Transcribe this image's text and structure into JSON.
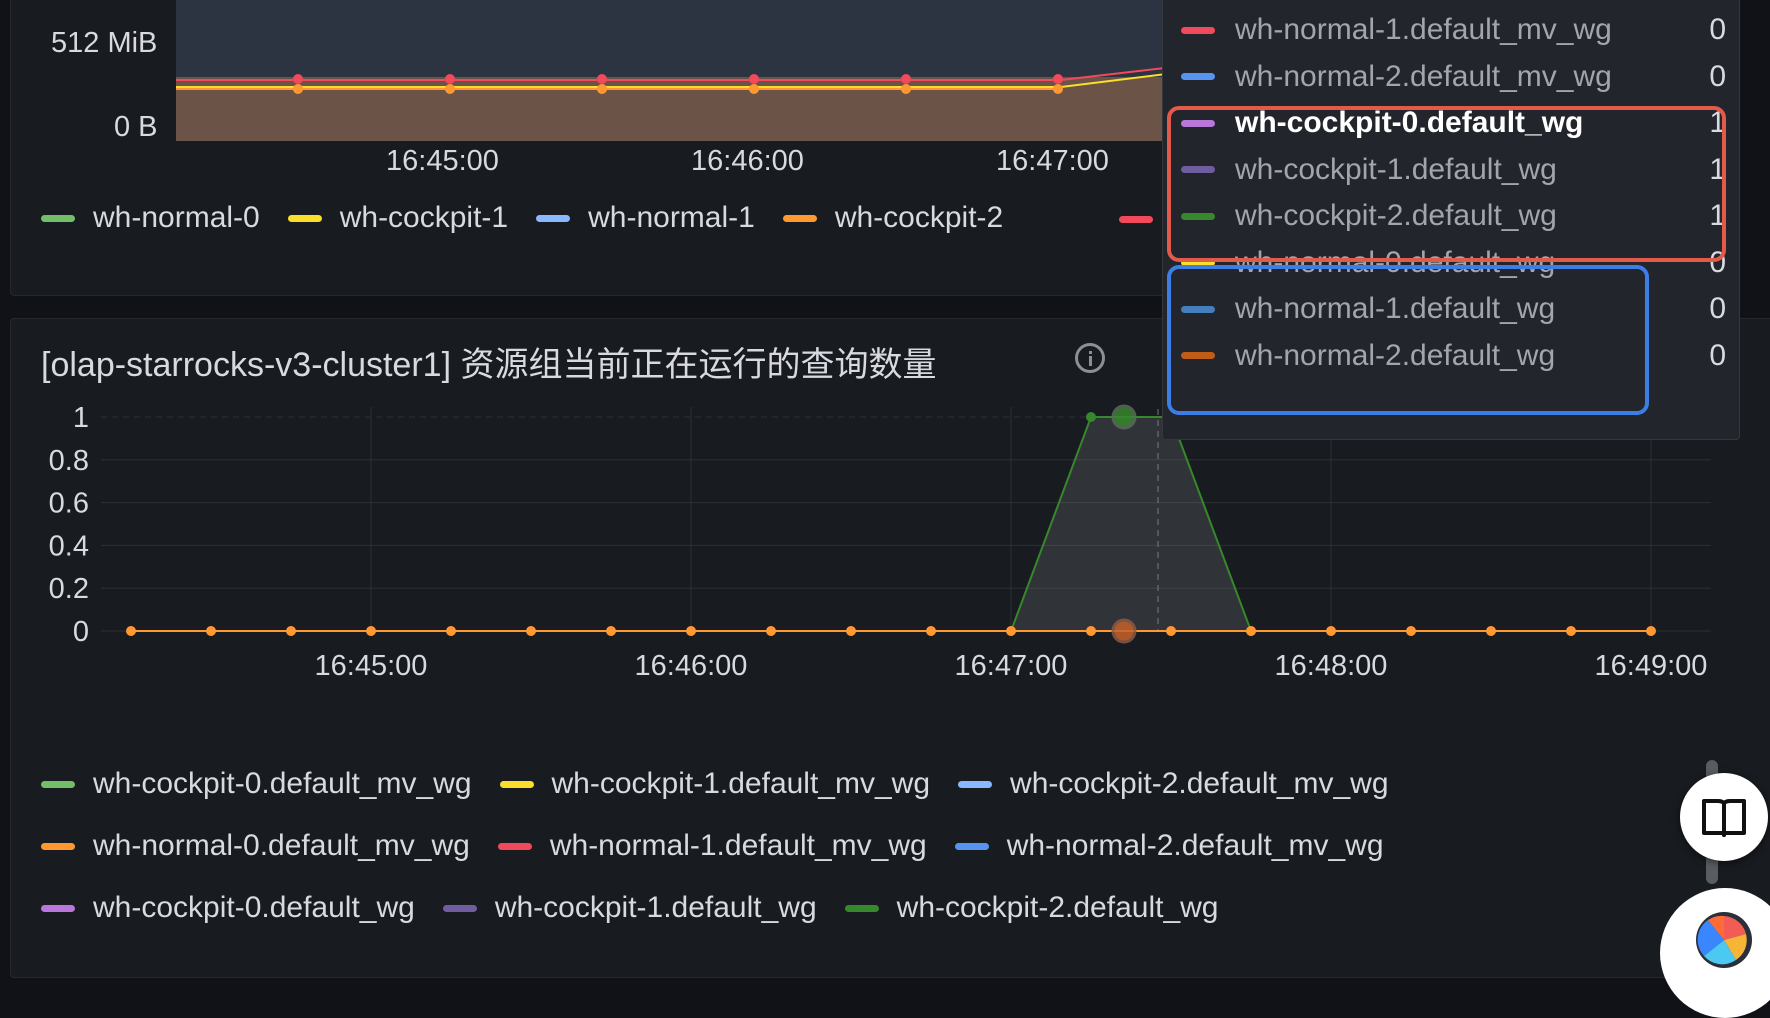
{
  "top_panel": {
    "y_ticks": [
      "512 MiB",
      "0 B"
    ],
    "x_ticks": [
      "16:45:00",
      "16:46:00",
      "16:47:00"
    ],
    "legend": [
      {
        "label": "wh-normal-0",
        "color": "#73bf69"
      },
      {
        "label": "wh-cockpit-1",
        "color": "#fade2a"
      },
      {
        "label": "wh-normal-1",
        "color": "#8ab8ff"
      },
      {
        "label": "wh-cockpit-2",
        "color": "#ff9830"
      }
    ]
  },
  "tooltip": {
    "rows": [
      {
        "name": "wh-normal-1.default_mv_wg",
        "value": "0",
        "color": "#f2495c"
      },
      {
        "name": "wh-normal-2.default_mv_wg",
        "value": "0",
        "color": "#5794f2"
      },
      {
        "name": "wh-cockpit-0.default_wg",
        "value": "1",
        "color": "#b877d9"
      },
      {
        "name": "wh-cockpit-1.default_wg",
        "value": "1",
        "color": "#705da0"
      },
      {
        "name": "wh-cockpit-2.default_wg",
        "value": "1",
        "color": "#37872d"
      },
      {
        "name": "wh-normal-0.default_wg",
        "value": "0",
        "color": "#fade2a"
      },
      {
        "name": "wh-normal-1.default_wg",
        "value": "0",
        "color": "#447ebc"
      },
      {
        "name": "wh-normal-2.default_wg",
        "value": "0",
        "color": "#c15c17"
      }
    ]
  },
  "bottom_panel": {
    "title": "[olap-starrocks-v3-cluster1] 资源组当前正在运行的查询数量",
    "legend": [
      {
        "label": "wh-cockpit-0.default_mv_wg",
        "color": "#73bf69"
      },
      {
        "label": "wh-cockpit-1.default_mv_wg",
        "color": "#fade2a"
      },
      {
        "label": "wh-cockpit-2.default_mv_wg",
        "color": "#8ab8ff"
      },
      {
        "label": "wh-normal-0.default_mv_wg",
        "color": "#ff9830"
      },
      {
        "label": "wh-normal-1.default_mv_wg",
        "color": "#f2495c"
      },
      {
        "label": "wh-normal-2.default_mv_wg",
        "color": "#5794f2"
      },
      {
        "label": "wh-cockpit-0.default_wg",
        "color": "#b877d9"
      },
      {
        "label": "wh-cockpit-1.default_wg",
        "color": "#705da0"
      },
      {
        "label": "wh-cockpit-2.default_wg",
        "color": "#37872d"
      }
    ]
  },
  "chart_data": {
    "type": "line",
    "title": "[olap-starrocks-v3-cluster1] 资源组当前正在运行的查询数量",
    "y_ticks": [
      "1",
      "0.8",
      "0.6",
      "0.4",
      "0.2",
      "0"
    ],
    "x_ticks": [
      "16:45:00",
      "16:46:00",
      "16:47:00",
      "16:48:00",
      "16:49:00"
    ],
    "ylim": [
      0,
      1
    ],
    "x": [
      "16:44:15",
      "16:44:30",
      "16:44:45",
      "16:45:00",
      "16:45:15",
      "16:45:30",
      "16:45:45",
      "16:46:00",
      "16:46:15",
      "16:46:30",
      "16:46:45",
      "16:47:00",
      "16:47:15",
      "16:47:30",
      "16:47:45",
      "16:48:00",
      "16:48:15",
      "16:48:30",
      "16:48:45",
      "16:49:00"
    ],
    "series": [
      {
        "name": "wh-cockpit-2.default_wg",
        "color": "#37872d",
        "values": [
          0,
          0,
          0,
          0,
          0,
          0,
          0,
          0,
          0,
          0,
          0,
          0,
          1,
          1,
          0,
          0,
          0,
          0,
          0,
          0
        ]
      },
      {
        "name": "wh-normal-0.default_mv_wg",
        "color": "#ff9830",
        "values": [
          0,
          0,
          0,
          0,
          0,
          0,
          0,
          0,
          0,
          0,
          0,
          0,
          0,
          0,
          0,
          0,
          0,
          0,
          0,
          0
        ]
      }
    ]
  }
}
